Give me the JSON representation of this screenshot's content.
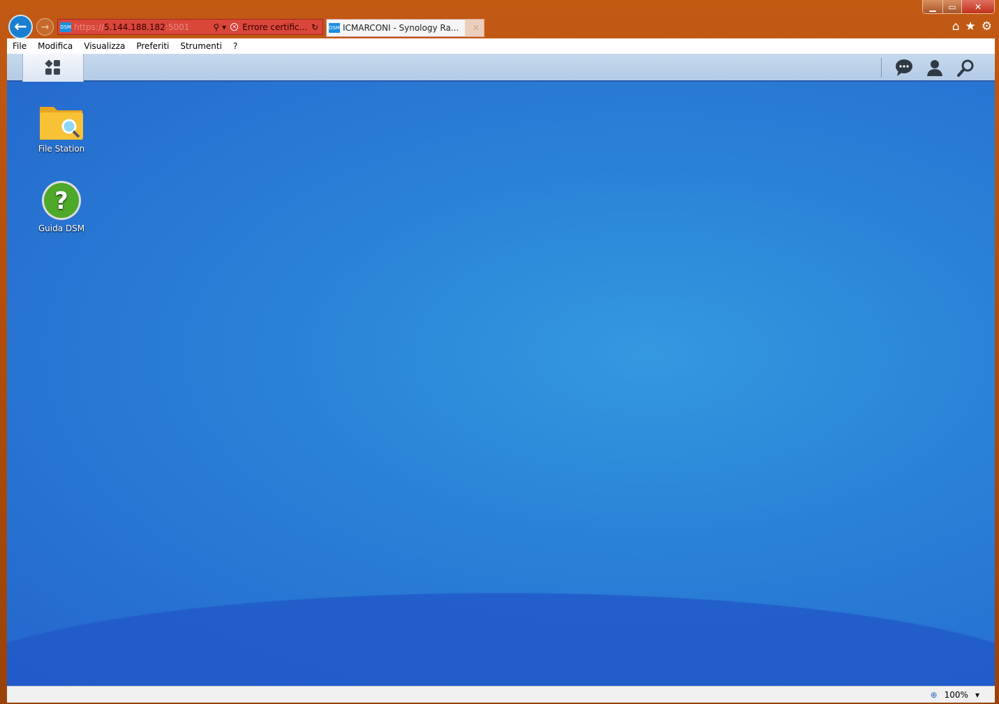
{
  "browser": {
    "address": {
      "prefix": "https://",
      "host": "5.144.188.182",
      "suffix": ":5001",
      "cert_error": "Errore certific..."
    },
    "tab": {
      "title": "ICMARCONI - Synology Ra...",
      "favicon": "DSM"
    },
    "menu": [
      "File",
      "Modifica",
      "Visualizza",
      "Preferiti",
      "Strumenti",
      "?"
    ],
    "zoom": "100%"
  },
  "dsm": {
    "desktop_icons": [
      {
        "label": "File Station"
      },
      {
        "label": "Guida DSM"
      }
    ]
  },
  "colors": {
    "taskbar": "#c6d9ee",
    "desktop": "#2a82d8",
    "frame": "#c25a14"
  }
}
